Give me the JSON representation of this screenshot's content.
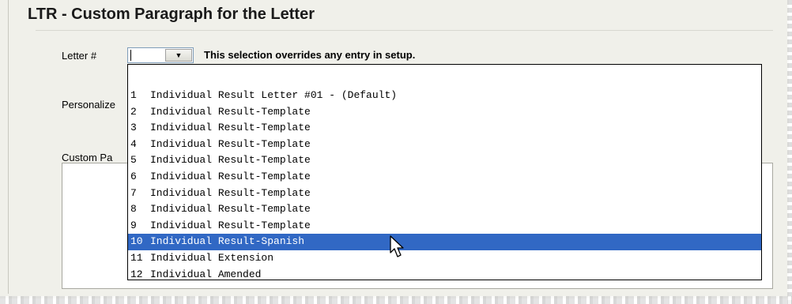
{
  "section": {
    "title": "LTR - Custom Paragraph for the Letter"
  },
  "form": {
    "letter_label": "Letter #",
    "letter_value": "",
    "override_note": "This selection overrides any entry in setup.",
    "personalize_label": "Personalize",
    "custom_paragraph_label": "Custom Pa"
  },
  "dropdown": {
    "selected_index": 9,
    "items": [
      {
        "num": "1",
        "label": "Individual Result Letter #01 - (Default)"
      },
      {
        "num": "2",
        "label": "Individual Result-Template"
      },
      {
        "num": "3",
        "label": "Individual Result-Template"
      },
      {
        "num": "4",
        "label": "Individual Result-Template"
      },
      {
        "num": "5",
        "label": "Individual Result-Template"
      },
      {
        "num": "6",
        "label": "Individual Result-Template"
      },
      {
        "num": "7",
        "label": "Individual Result-Template"
      },
      {
        "num": "8",
        "label": "Individual Result-Template"
      },
      {
        "num": "9",
        "label": "Individual Result-Template"
      },
      {
        "num": "10",
        "label": "Individual Result-Spanish"
      },
      {
        "num": "11",
        "label": "Individual Extension"
      },
      {
        "num": "12",
        "label": "Individual Amended"
      }
    ]
  },
  "colors": {
    "selection": "#3168c4",
    "panel": "#f0f0ea"
  },
  "icons": {
    "combo_arrow": "dropdown-arrow-icon",
    "cursor": "mouse-pointer-icon"
  }
}
